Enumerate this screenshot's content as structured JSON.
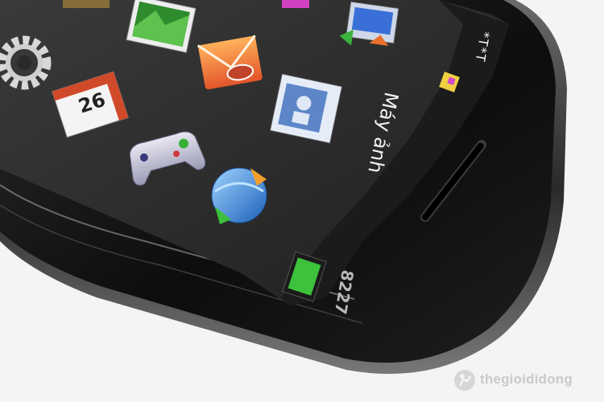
{
  "photo": {
    "device_model_label": "8227",
    "screen_caption": "Máy ảnh",
    "calendar_icon_number": "26",
    "status_glyphs": "*T*T",
    "watermark": "thegioididong",
    "screen_icons": [
      {
        "name": "settings-gear-icon"
      },
      {
        "name": "wallpaper-picture-icon"
      },
      {
        "name": "messages-envelope-icon"
      },
      {
        "name": "file-transfer-icon"
      },
      {
        "name": "calendar-icon"
      },
      {
        "name": "contacts-notebook-icon"
      },
      {
        "name": "gamepad-icon"
      },
      {
        "name": "browser-globe-icon"
      }
    ],
    "colors": {
      "background": "#f4f4f4",
      "device_body": "#111111",
      "screen": "#2a2a2a",
      "battery_green": "#3cc23c"
    }
  }
}
